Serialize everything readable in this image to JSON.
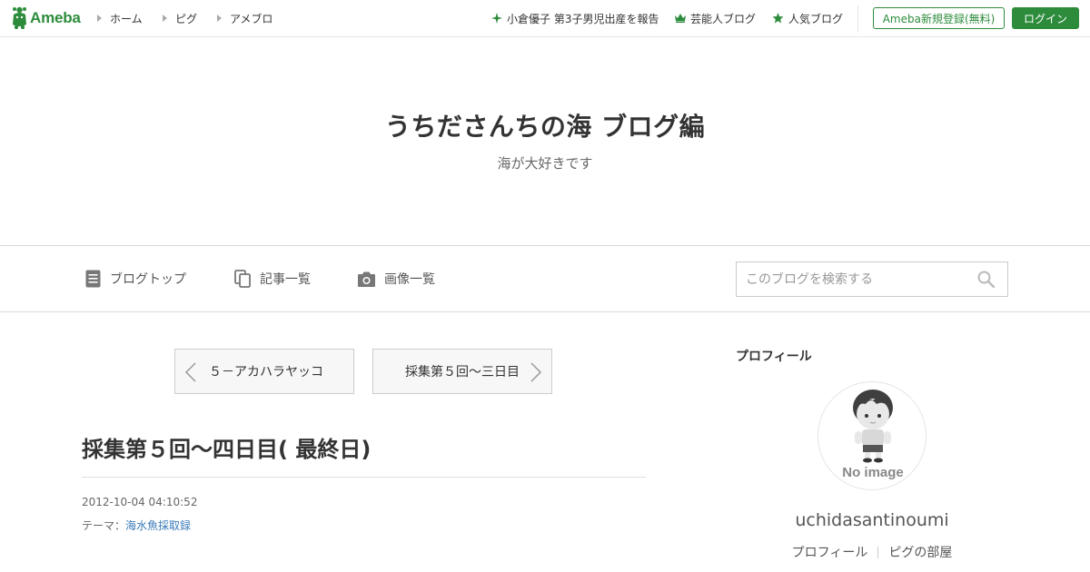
{
  "header": {
    "logo_text": "Ameba",
    "nav": [
      "ホーム",
      "ピグ",
      "アメブロ"
    ],
    "right_links": [
      "小倉優子 第3子男児出産を報告",
      "芸能人ブログ",
      "人気ブログ"
    ],
    "register_button": "Ameba新規登録(無料)",
    "login_button": "ログイン"
  },
  "blog": {
    "title": "うちださんちの海 ブログ編",
    "description": "海が大好きです"
  },
  "blog_nav": {
    "items": [
      "ブログトップ",
      "記事一覧",
      "画像一覧"
    ],
    "search_placeholder": "このブログを検索する"
  },
  "entry": {
    "prev_label": "５－アカハラヤッコ",
    "next_label": "採集第５回～三日目",
    "title": "採集第５回～四日目( 最終日)",
    "date": "2012-10-04 04:10:52",
    "theme_label": "テーマ：",
    "theme_value": "海水魚採取録"
  },
  "sidebar": {
    "heading": "プロフィール",
    "avatar_caption": "No image",
    "name": "uchidasantinoumi",
    "links": [
      "プロフィール",
      "ピグの部屋"
    ]
  },
  "colors": {
    "brand": "#2d8c3c",
    "link": "#3a7bb8"
  },
  "icons": [
    "ameba-logo-icon",
    "triangle-right-icon",
    "sparkle-icon",
    "crown-icon",
    "star-icon",
    "document-icon",
    "copy-icon",
    "camera-icon",
    "search-icon",
    "chevron-left-icon",
    "chevron-right-icon"
  ]
}
